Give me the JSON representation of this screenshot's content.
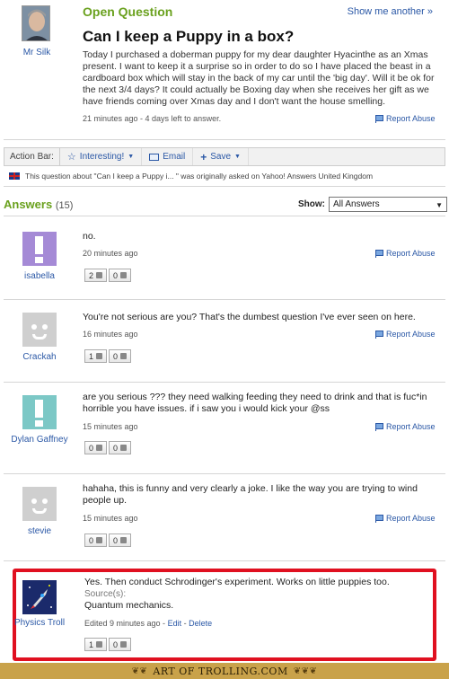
{
  "question": {
    "header": "Open Question",
    "show_another": "Show me another »",
    "user": "Mr Silk",
    "title": "Can I keep a Puppy in a box?",
    "body": "Today I purchased a doberman puppy for my dear daughter Hyacinthe as an Xmas present. I want to keep it a surprise so in order to do so I have placed the beast in a cardboard box which will stay in the back of my car until the 'big day'. Will it be ok for the next 3/4 days? It could actually be Boxing day when she receives her gift as we have friends coming over Xmas day and I don't want the house smelling.",
    "meta": "21 minutes ago - 4 days left to answer.",
    "report": "Report Abuse"
  },
  "action_bar": {
    "label": "Action Bar:",
    "interesting": "Interesting!",
    "email": "Email",
    "save": "Save"
  },
  "origin_note": "This question about \"Can I keep a Puppy i... \" was originally asked on Yahoo! Answers United Kingdom",
  "answers_header": {
    "title": "Answers",
    "count": "(15)",
    "show_label": "Show:",
    "show_value": "All Answers"
  },
  "answers": [
    {
      "user": "isabella",
      "text": "no.",
      "time": "20 minutes ago",
      "up": "2",
      "down": "0",
      "report": "Report Abuse"
    },
    {
      "user": "Crackah",
      "text": "You're not serious are you? That's the dumbest question I've ever seen on here.",
      "time": "16 minutes ago",
      "up": "1",
      "down": "0",
      "report": "Report Abuse"
    },
    {
      "user": "Dylan Gaffney",
      "text": "are you serious ??? they need walking feeding they need to drink and that is fuc*in horrible you have issues. if i saw you i would kick your @ss",
      "time": "15 minutes ago",
      "up": "0",
      "down": "0",
      "report": "Report Abuse"
    },
    {
      "user": "stevie",
      "text": "hahaha, this is funny and very clearly a joke. I like the way you are trying to wind people up.",
      "time": "15 minutes ago",
      "up": "0",
      "down": "0",
      "report": "Report Abuse"
    },
    {
      "user": "Physics Troll",
      "text": "Yes. Then conduct Schrodinger's experiment. Works on little puppies too.",
      "source_label": "Source(s):",
      "source": "Quantum mechanics.",
      "edited": "Edited 9 minutes ago - ",
      "edit": "Edit",
      "dash": " - ",
      "delete": "Delete",
      "up": "1",
      "down": "0"
    }
  ],
  "footer": "ART OF TROLLING.COM"
}
